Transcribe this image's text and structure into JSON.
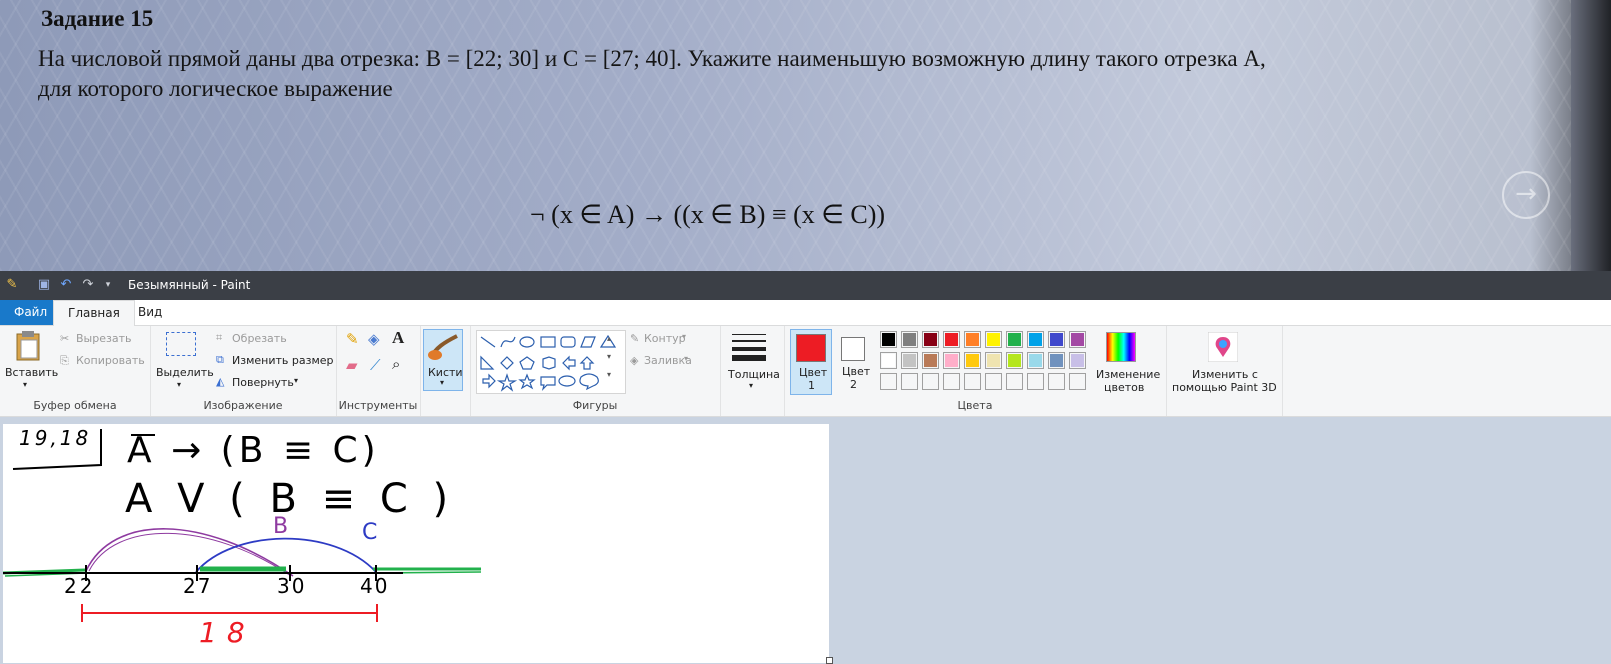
{
  "photo": {
    "task_title": "Задание 15",
    "line1": "На числовой прямой даны два отрезка: B = [22; 30] и C = [27; 40]. Укажите наименьшую возможную длину такого отрезка A,",
    "line2": "для которого логическое выражение",
    "formula": "¬ (x ∈ A) → ((x ∈ B) ≡ (x ∈ C))"
  },
  "window": {
    "title": "Безымянный - Paint"
  },
  "menu": {
    "file": "Файл",
    "home": "Главная",
    "view": "Вид"
  },
  "ribbon": {
    "clipboard": {
      "label": "Буфер обмена",
      "paste": "Вставить",
      "cut": "Вырезать",
      "copy": "Копировать"
    },
    "image": {
      "label": "Изображение",
      "select": "Выделить",
      "crop": "Обрезать",
      "resize": "Изменить размер",
      "rotate": "Повернуть"
    },
    "tools": {
      "label": "Инструменты"
    },
    "brushes": {
      "label": "Кисти"
    },
    "shapes": {
      "label": "Фигуры",
      "outline": "Контур",
      "fill": "Заливка"
    },
    "size": {
      "label": "Толщина"
    },
    "colors": {
      "label": "Цвета",
      "color1_line1": "Цвет",
      "color1_line2": "1",
      "color2_line1": "Цвет",
      "color2_line2": "2",
      "color1": "#ed1c24",
      "color2": "#ffffff",
      "edit_line1": "Изменение",
      "edit_line2": "цветов",
      "palette_row1": [
        "#000000",
        "#7f7f7f",
        "#880015",
        "#ed1c24",
        "#ff7f27",
        "#fff200",
        "#22b14c",
        "#00a2e8",
        "#3f48cc",
        "#a349a4"
      ],
      "palette_row2": [
        "#ffffff",
        "#c3c3c3",
        "#b97a57",
        "#ffaec9",
        "#ffc90e",
        "#efe4b0",
        "#b5e61d",
        "#99d9ea",
        "#7092be",
        "#c8bfe7"
      ]
    },
    "paint3d": {
      "line1": "Изменить с",
      "line2": "помощью Paint 3D"
    }
  },
  "drawing": {
    "boxed_number": "19,18",
    "expr1": "A → (B ≡ C)",
    "expr2": "A V ( B ≡ C )",
    "label_b": "B",
    "label_c": "C",
    "tick_22": "22",
    "tick_27": "27",
    "tick_30": "30",
    "tick_40": "40",
    "length": "18",
    "colors": {
      "ink": "#000000",
      "purple": "#8e3aa0",
      "blue": "#2d3bc4",
      "green": "#22b14c",
      "red": "#ed1c24"
    }
  }
}
